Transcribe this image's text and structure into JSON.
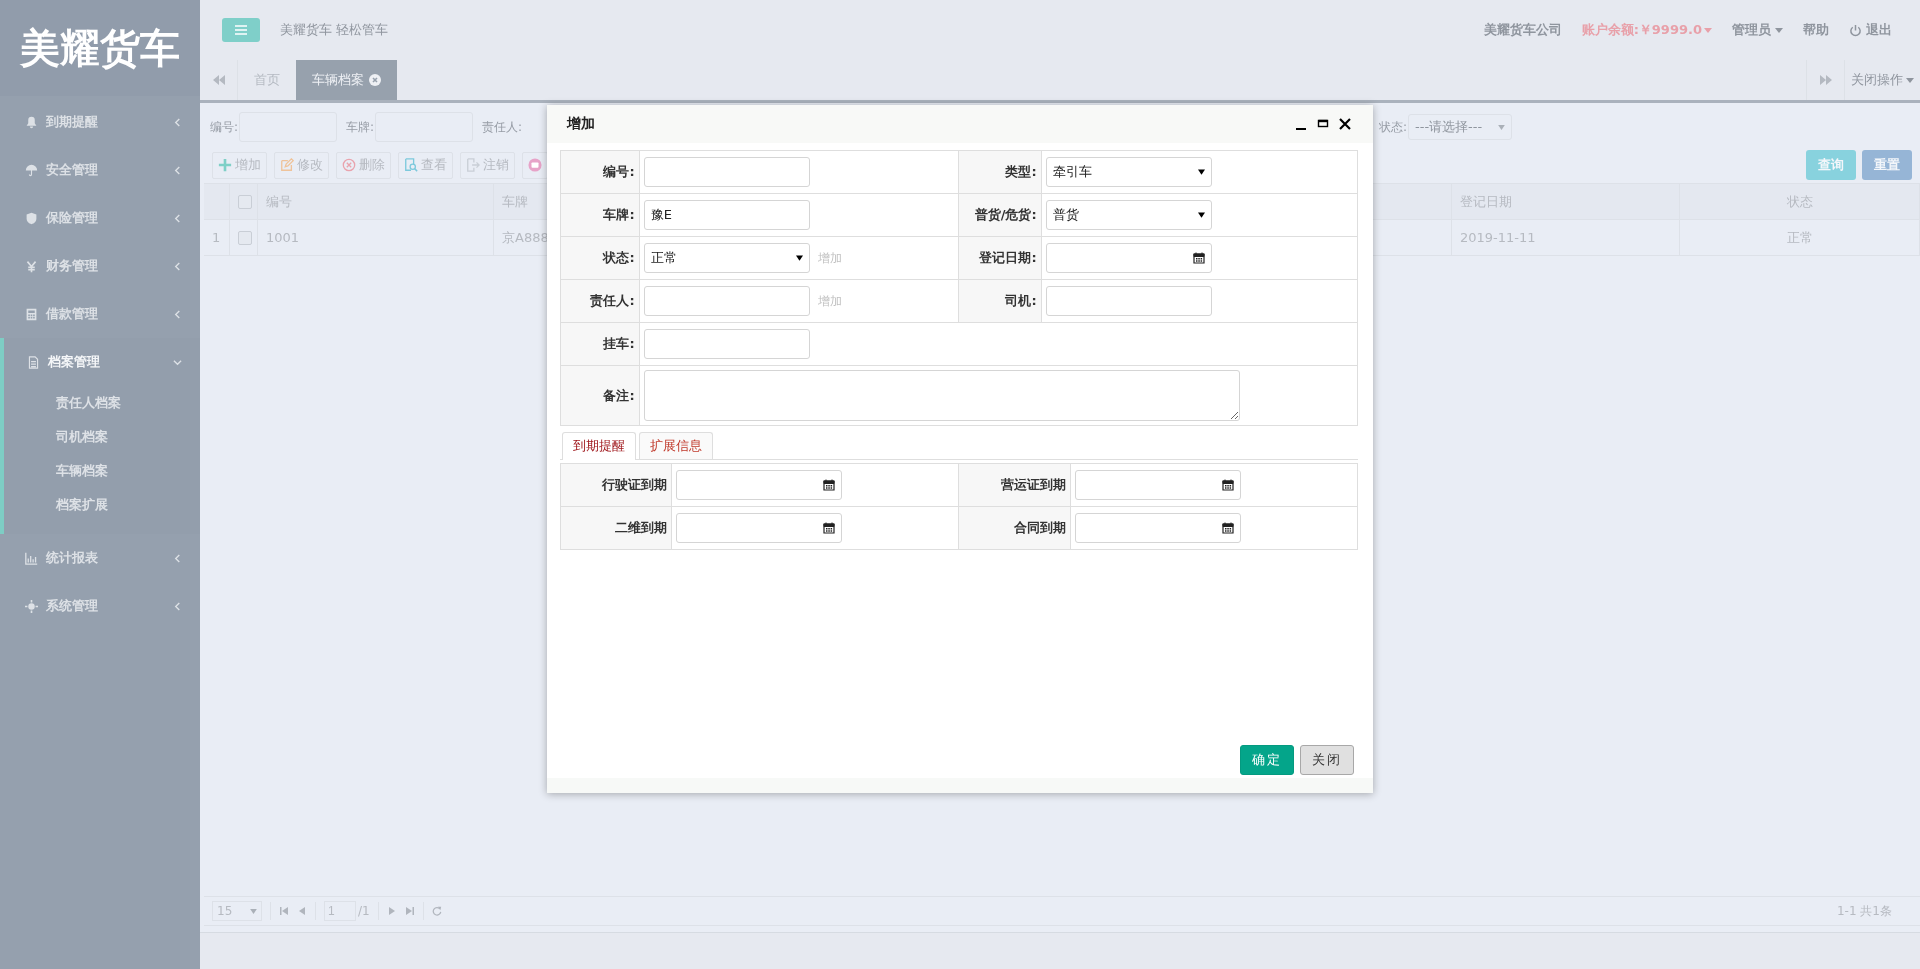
{
  "sidebar": {
    "logo": "美耀货车",
    "items": [
      {
        "label": "到期提醒",
        "expanded": false
      },
      {
        "label": "安全管理",
        "expanded": false
      },
      {
        "label": "保险管理",
        "expanded": false
      },
      {
        "label": "财务管理",
        "expanded": false
      },
      {
        "label": "借款管理",
        "expanded": false
      },
      {
        "label": "档案管理",
        "expanded": true,
        "children": [
          {
            "label": "责任人档案"
          },
          {
            "label": "司机档案"
          },
          {
            "label": "车辆档案"
          },
          {
            "label": "档案扩展"
          }
        ]
      },
      {
        "label": "统计报表",
        "expanded": false
      },
      {
        "label": "系统管理",
        "expanded": false
      }
    ]
  },
  "header": {
    "subtitle": "美耀货车 轻松管车",
    "company": "美耀货车公司",
    "balance": "账户余额:￥9999.0",
    "user": "管理员",
    "help": "帮助",
    "logout": "退出"
  },
  "tabs": [
    {
      "label": "首页",
      "selected": false,
      "closable": false
    },
    {
      "label": "车辆档案",
      "selected": true,
      "closable": true
    }
  ],
  "close_menu": "关闭操作",
  "search": {
    "fields": [
      {
        "label": "编号:"
      },
      {
        "label": "车牌:"
      }
    ],
    "partial_label": "责任人:",
    "status": {
      "label": "状态:",
      "placeholder": "---请选择---"
    },
    "buttons": [
      {
        "label": "查询",
        "kind": "query"
      },
      {
        "label": "重置",
        "kind": "reset"
      }
    ]
  },
  "toolbar": [
    {
      "kind": "add",
      "label": "增加"
    },
    {
      "kind": "edit",
      "label": "修改"
    },
    {
      "kind": "delete",
      "label": "删除"
    },
    {
      "kind": "view",
      "label": "查看"
    },
    {
      "kind": "cancel",
      "label": "注销"
    },
    {
      "kind": "image"
    }
  ],
  "table": {
    "columns": [
      "编号",
      "车牌",
      "登记日期",
      "状态"
    ],
    "header_checked": false,
    "rows": [
      {
        "index": "1",
        "checked": false,
        "cells": [
          "1001",
          "京A888",
          "2019-11-11",
          "正常"
        ]
      }
    ]
  },
  "pager": {
    "page_size": "15",
    "page": "1",
    "total_pages": "/1",
    "summary": "1-1 共1条"
  },
  "dialog": {
    "title": "增加",
    "rows": [
      [
        {
          "label": "编号:",
          "kind": "text"
        },
        {
          "label": "类型:",
          "kind": "select",
          "value": "牵引车"
        }
      ],
      [
        {
          "label": "车牌:",
          "kind": "text",
          "value": "豫E"
        },
        {
          "label": "普货/危货:",
          "kind": "select",
          "value": "普货"
        }
      ],
      [
        {
          "label": "状态:",
          "kind": "select",
          "value": "正常",
          "action": "增加"
        },
        {
          "label": "登记日期:",
          "kind": "date"
        }
      ],
      [
        {
          "label": "责任人:",
          "kind": "text",
          "action": "增加"
        },
        {
          "label": "司机:",
          "kind": "text"
        }
      ],
      [
        {
          "label": "挂车:",
          "kind": "text"
        }
      ],
      [
        {
          "label": "备注:",
          "kind": "textarea"
        }
      ]
    ],
    "tabs": [
      {
        "label": "到期提醒",
        "selected": true
      },
      {
        "label": "扩展信息",
        "selected": false
      }
    ],
    "expiry_rows": [
      [
        {
          "label": "行驶证到期"
        },
        {
          "label": "营运证到期"
        }
      ],
      [
        {
          "label": "二维到期"
        },
        {
          "label": "合同到期"
        }
      ]
    ],
    "buttons": [
      {
        "label": "确定",
        "kind": "primary"
      },
      {
        "label": "关闭",
        "kind": "default"
      }
    ]
  }
}
